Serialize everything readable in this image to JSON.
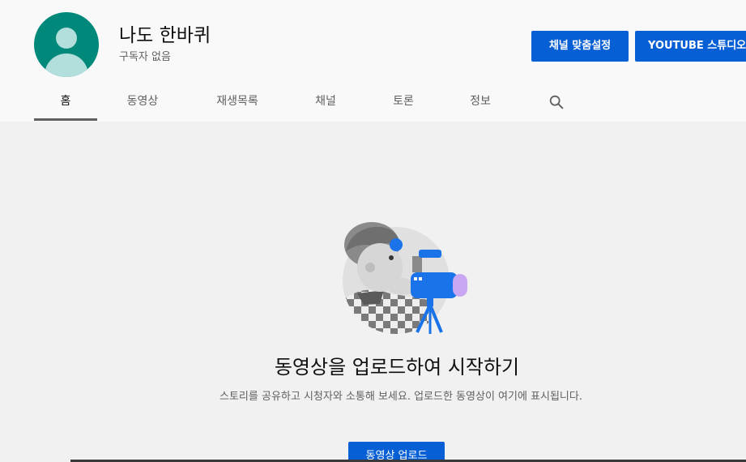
{
  "channel": {
    "name": "나도 한바퀴",
    "subscribers": "구독자 없음"
  },
  "actions": {
    "customize_label": "채널 맞춤설정",
    "studio_label": "YOUTUBE 스튜디오"
  },
  "tabs": [
    {
      "label": "홈",
      "active": true
    },
    {
      "label": "동영상",
      "active": false
    },
    {
      "label": "재생목록",
      "active": false
    },
    {
      "label": "채널",
      "active": false
    },
    {
      "label": "토론",
      "active": false
    },
    {
      "label": "정보",
      "active": false
    }
  ],
  "icons": {
    "search": "search-icon",
    "avatar": "default-avatar-icon",
    "illustration": "camera-person-illustration"
  },
  "empty_state": {
    "title": "동영상을 업로드하여 시작하기",
    "description": "스토리를 공유하고 시청자와 소통해 보세요. 업로드한 동영상이 여기에 표시됩니다.",
    "upload_label": "동영상 업로드"
  },
  "colors": {
    "accent": "#065fd4",
    "avatar": "#00897b"
  }
}
